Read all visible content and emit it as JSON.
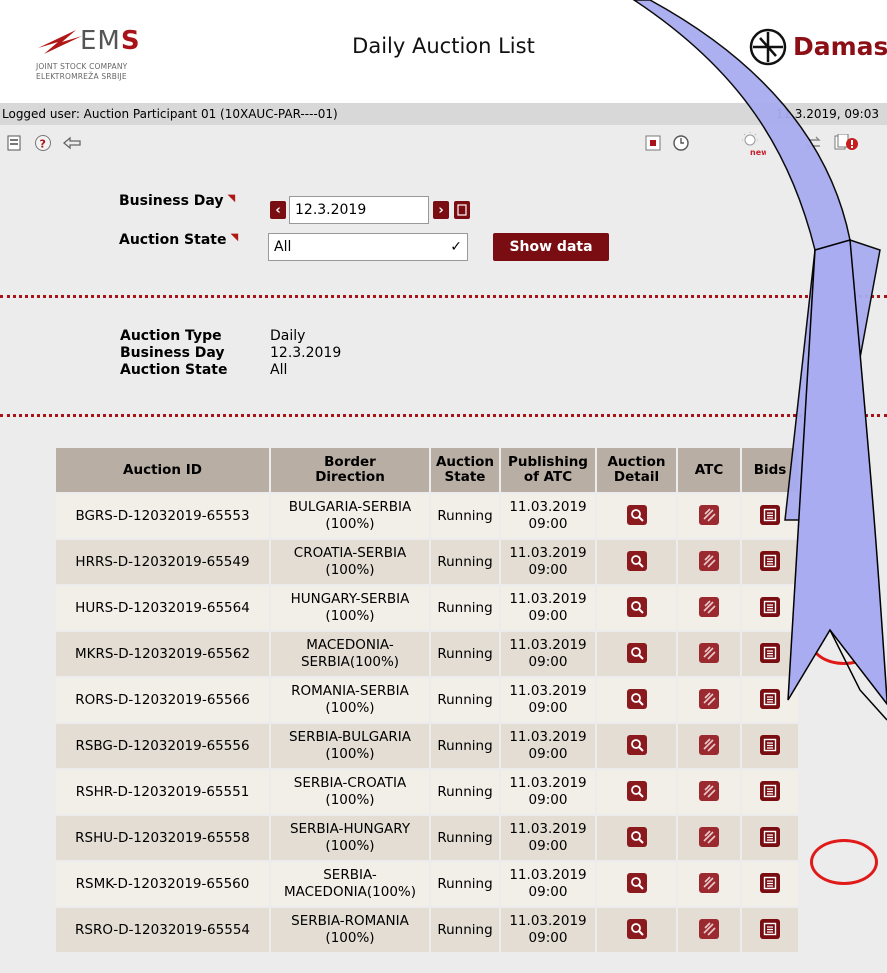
{
  "header": {
    "title": "Daily Auction List",
    "ems_logo": {
      "word_prefix": "EM",
      "word_suffix": "S",
      "line1": "JOINT STOCK COMPANY",
      "line2": "ELEKTROMREŽA SRBIJE"
    },
    "damas_logo": {
      "word": "Damas"
    }
  },
  "userbar": {
    "logged_user": "Logged user: Auction Participant 01 (10XAUC-PAR----01)",
    "datetime": "11.3.2019, 09:03"
  },
  "toolbar": {
    "icons": [
      "document-icon",
      "help-icon",
      "back-arrow-icon",
      "stop-icon",
      "clock-icon",
      "new-bulb-icon",
      "exchange-icon",
      "alert-docs-icon"
    ],
    "new_badge": "new"
  },
  "filter": {
    "business_day_label": "Business Day",
    "business_day_value": "12.3.2019",
    "auction_state_label": "Auction State",
    "auction_state_value": "All",
    "show_button": "Show data"
  },
  "summary": {
    "type_key": "Auction Type",
    "type_val": "Daily",
    "day_key": "Business Day",
    "day_val": "12.3.2019",
    "state_key": "Auction State",
    "state_val": "All"
  },
  "table": {
    "headers": {
      "id": "Auction ID",
      "border": [
        "Border",
        "Direction"
      ],
      "state": [
        "Auction",
        "State"
      ],
      "publishing": [
        "Publishing",
        "of ATC"
      ],
      "detail": [
        "Auction",
        "Detail"
      ],
      "atc": "ATC",
      "bids": "Bids"
    },
    "rows": [
      {
        "id": "BGRS-D-12032019-65553",
        "border1": "BULGARIA-SERBIA",
        "border2": "(100%)",
        "state": "Running",
        "pub1": "11.03.2019",
        "pub2": "09:00"
      },
      {
        "id": "HRRS-D-12032019-65549",
        "border1": "CROATIA-SERBIA",
        "border2": "(100%)",
        "state": "Running",
        "pub1": "11.03.2019",
        "pub2": "09:00"
      },
      {
        "id": "HURS-D-12032019-65564",
        "border1": "HUNGARY-SERBIA",
        "border2": "(100%)",
        "state": "Running",
        "pub1": "11.03.2019",
        "pub2": "09:00"
      },
      {
        "id": "MKRS-D-12032019-65562",
        "border1": "MACEDONIA-",
        "border2": "SERBIA(100%)",
        "state": "Running",
        "pub1": "11.03.2019",
        "pub2": "09:00"
      },
      {
        "id": "RORS-D-12032019-65566",
        "border1": "ROMANIA-SERBIA",
        "border2": "(100%)",
        "state": "Running",
        "pub1": "11.03.2019",
        "pub2": "09:00"
      },
      {
        "id": "RSBG-D-12032019-65556",
        "border1": "SERBIA-BULGARIA",
        "border2": "(100%)",
        "state": "Running",
        "pub1": "11.03.2019",
        "pub2": "09:00"
      },
      {
        "id": "RSHR-D-12032019-65551",
        "border1": "SERBIA-CROATIA",
        "border2": "(100%)",
        "state": "Running",
        "pub1": "11.03.2019",
        "pub2": "09:00"
      },
      {
        "id": "RSHU-D-12032019-65558",
        "border1": "SERBIA-HUNGARY",
        "border2": "(100%)",
        "state": "Running",
        "pub1": "11.03.2019",
        "pub2": "09:00"
      },
      {
        "id": "RSMK-D-12032019-65560",
        "border1": "SERBIA-",
        "border2": "MACEDONIA(100%)",
        "state": "Running",
        "pub1": "11.03.2019",
        "pub2": "09:00"
      },
      {
        "id": "RSRO-D-12032019-65554",
        "border1": "SERBIA-ROMANIA",
        "border2": "(100%)",
        "state": "Running",
        "pub1": "11.03.2019",
        "pub2": "09:00"
      }
    ]
  },
  "colors": {
    "brand": "#7a0d12",
    "header_cell": "#b9aea3",
    "annotation_arrow": "#a9acf0",
    "highlight": "#e01919"
  }
}
